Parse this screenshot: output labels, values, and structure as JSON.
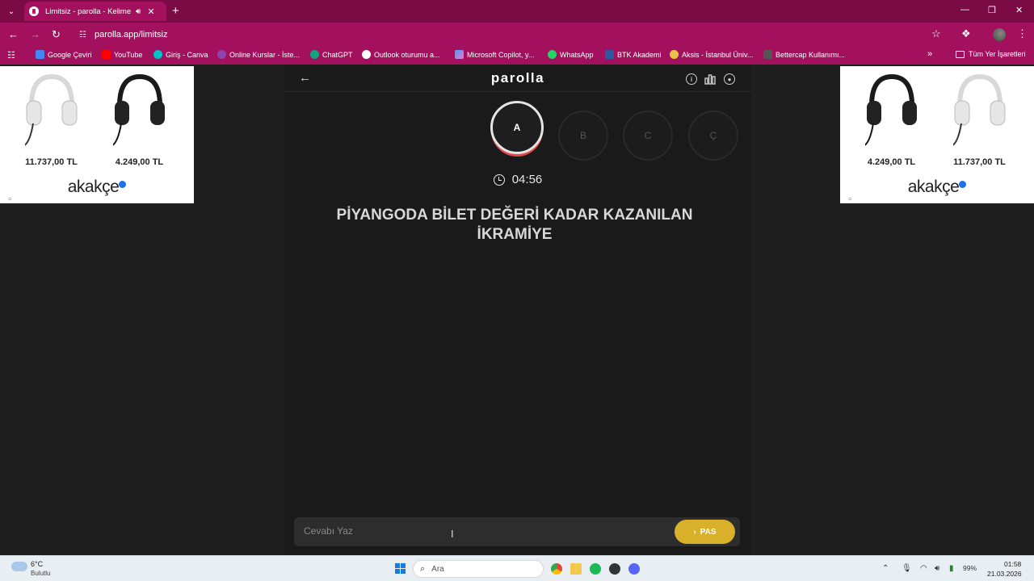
{
  "browser": {
    "tab": {
      "title": "Limitsiz - parolla - Kelime c"
    },
    "url": "parolla.app/limitsiz",
    "bookmarks": [
      {
        "label": "Google Çeviri",
        "color": "#4285f4"
      },
      {
        "label": "YouTube",
        "color": "#ff0000"
      },
      {
        "label": "Giriş - Canva",
        "color": "#00c4cc"
      },
      {
        "label": "Online Kurslar - İste...",
        "color": "#8e44ad"
      },
      {
        "label": "ChatGPT",
        "color": "#10a37f"
      },
      {
        "label": "Outlook oturumu a...",
        "color": "#ffffff"
      },
      {
        "label": "Microsoft Copilot, y...",
        "color": "#7b61ff"
      },
      {
        "label": "WhatsApp",
        "color": "#25d366"
      },
      {
        "label": "BTK Akademi",
        "color": "#2c5aa0"
      },
      {
        "label": "Aksis - İstanbul Üniv...",
        "color": "#e8c34a"
      },
      {
        "label": "Bettercap Kullanımı...",
        "color": "#555555"
      }
    ],
    "all_bookmarks": "Tüm Yer İşaretleri"
  },
  "ads": {
    "left": {
      "prices": [
        "11.737,00 TL",
        "4.249,00 TL"
      ],
      "logo": "akakçe"
    },
    "right": {
      "prices": [
        "4.249,00 TL",
        "11.737,00 TL"
      ],
      "logo": "akakçe"
    }
  },
  "game": {
    "logo": "parolla",
    "letters": [
      "A",
      "B",
      "C",
      "Ç"
    ],
    "active_letter": "A",
    "timer": "04:56",
    "question": "PİYANGODA BİLET DEĞERİ KADAR KAZANILAN İKRAMİYE",
    "answer_placeholder": "Cevabı Yaz",
    "pass_label": "PAS",
    "colors": {
      "pass": "#d9b02a",
      "active_ring": "#e24a4a"
    }
  },
  "taskbar": {
    "weather_temp": "6°C",
    "weather_desc": "Bulutlu",
    "search_placeholder": "Ara",
    "battery": "99%",
    "time": "01:58",
    "date": "21.03.2026"
  }
}
